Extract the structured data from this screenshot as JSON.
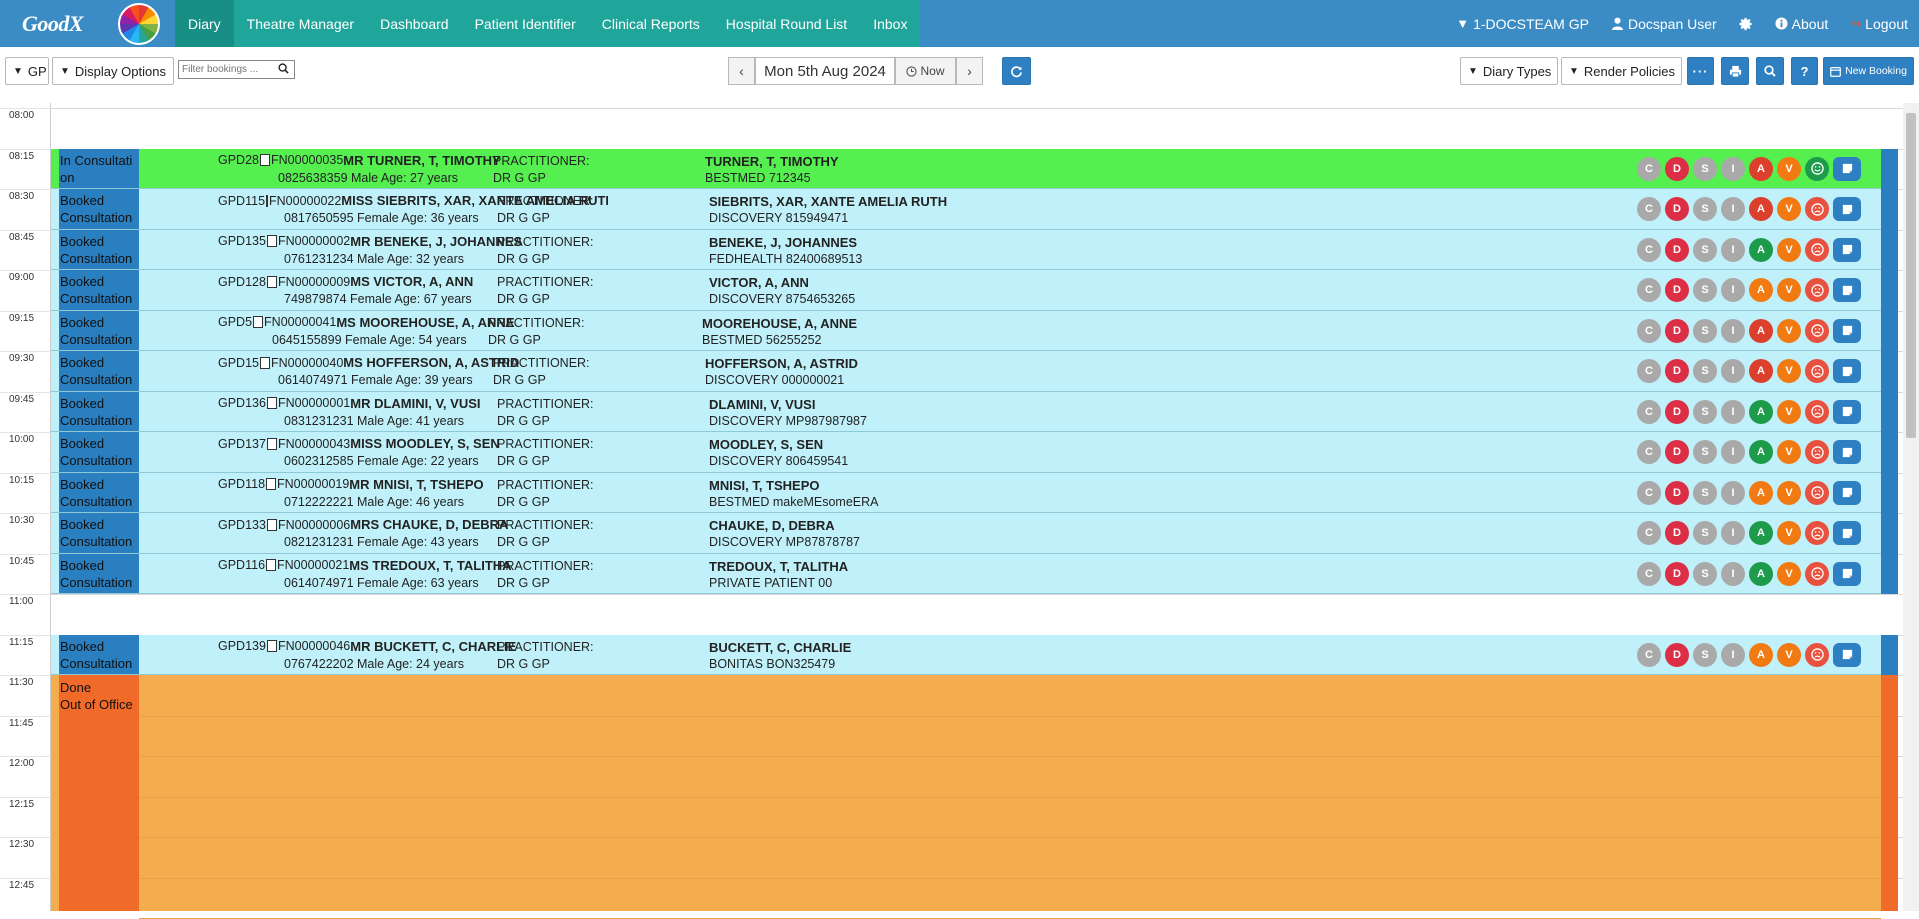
{
  "nav": {
    "logo_text": "GoodX",
    "items": [
      {
        "label": "Diary",
        "active": true
      },
      {
        "label": "Theatre Manager"
      },
      {
        "label": "Dashboard"
      },
      {
        "label": "Patient Identifier"
      },
      {
        "label": "Clinical Reports"
      },
      {
        "label": "Hospital Round List"
      },
      {
        "label": "Inbox"
      }
    ],
    "entity": "1-DOCSTEAM GP",
    "user": "Docspan User",
    "about": "About",
    "logout": "Logout"
  },
  "toolbar": {
    "gp_label": "GP",
    "display_options": "Display Options",
    "filter_placeholder": "Filter bookings ...",
    "date": "Mon 5th Aug 2024",
    "now": "Now",
    "diary_types": "Diary Types",
    "render_policies": "Render Policies",
    "new_booking": "New Booking"
  },
  "times": [
    "08:00",
    "08:15",
    "08:30",
    "08:45",
    "09:00",
    "09:15",
    "09:30",
    "09:45",
    "10:00",
    "10:15",
    "10:30",
    "10:45",
    "11:00",
    "11:15",
    "11:30",
    "11:45",
    "12:00",
    "12:15",
    "12:30",
    "12:45"
  ],
  "bookings": [
    {
      "slot": 1,
      "status1": "In Consultati",
      "status2": "on",
      "ref": "GPD28",
      "file": "FN00000035",
      "name": "MR TURNER, T, TIMOTHY",
      "details": "0825638359 Male Age: 27 years",
      "prac_label": "PRACTITIONER:",
      "prac": "DR G GP",
      "patient": "TURNER, T, TIMOTHY",
      "medical": "BESTMED 712345",
      "a": "red",
      "face": "happy",
      "kind": "green"
    },
    {
      "slot": 2,
      "status1": "Booked",
      "status2": "Consultation",
      "ref": "GPD115",
      "file": "FN00000022",
      "name": "MISS SIEBRITS, XAR, XANTE AMELIA RUTH",
      "details": "0817650595 Female Age: 36 years",
      "prac_label": "PRACTITIONER:",
      "prac": "DR G GP",
      "patient": "SIEBRITS, XAR, XANTE AMELIA RUTH",
      "medical": "DISCOVERY 815949471",
      "a": "red",
      "face": "sad",
      "kind": "blue"
    },
    {
      "slot": 3,
      "status1": "Booked",
      "status2": "Consultation",
      "ref": "GPD135",
      "file": "FN00000002",
      "name": "MR BENEKE, J, JOHANNES",
      "details": "0761231234 Male Age: 32 years",
      "prac_label": "PRACTITIONER:",
      "prac": "DR G GP",
      "patient": "BENEKE, J, JOHANNES",
      "medical": "FEDHEALTH 82400689513",
      "a": "green",
      "face": "sad",
      "kind": "blue"
    },
    {
      "slot": 4,
      "status1": "Booked",
      "status2": "Consultation",
      "ref": "GPD128",
      "file": "FN00000009",
      "name": "MS VICTOR, A, ANN",
      "details": "749879874 Female Age: 67 years",
      "prac_label": "PRACTITIONER:",
      "prac": "DR G GP",
      "patient": "VICTOR, A, ANN",
      "medical": "DISCOVERY 8754653265",
      "a": "orange",
      "face": "sad",
      "kind": "blue"
    },
    {
      "slot": 5,
      "status1": "Booked",
      "status2": "Consultation",
      "ref": "GPD5",
      "file": "FN00000041",
      "name": "MS MOOREHOUSE, A, ANNE",
      "details": "0645155899 Female Age: 54 years",
      "prac_label": "PRACTITIONER:",
      "prac": "DR G GP",
      "patient": "MOOREHOUSE, A, ANNE",
      "medical": "BESTMED 56255252",
      "a": "red",
      "face": "sad",
      "kind": "blue"
    },
    {
      "slot": 6,
      "status1": "Booked",
      "status2": "Consultation",
      "ref": "GPD15",
      "file": "FN00000040",
      "name": "MS HOFFERSON, A, ASTRID",
      "details": "0614074971 Female Age: 39 years",
      "prac_label": "PRACTITIONER:",
      "prac": "DR G GP",
      "patient": "HOFFERSON, A, ASTRID",
      "medical": "DISCOVERY 000000021",
      "a": "red",
      "face": "sad",
      "kind": "blue"
    },
    {
      "slot": 7,
      "status1": "Booked",
      "status2": "Consultation",
      "ref": "GPD136",
      "file": "FN00000001",
      "name": "MR DLAMINI, V, VUSI",
      "details": "0831231231 Male Age: 41 years",
      "prac_label": "PRACTITIONER:",
      "prac": "DR G GP",
      "patient": "DLAMINI, V, VUSI",
      "medical": "DISCOVERY MP987987987",
      "a": "green",
      "face": "sad",
      "kind": "blue"
    },
    {
      "slot": 8,
      "status1": "Booked",
      "status2": "Consultation",
      "ref": "GPD137",
      "file": "FN00000043",
      "name": "MISS MOODLEY, S, SEN",
      "details": "0602312585 Female Age: 22 years",
      "prac_label": "PRACTITIONER:",
      "prac": "DR G GP",
      "patient": "MOODLEY, S, SEN",
      "medical": "DISCOVERY 806459541",
      "a": "green",
      "face": "sad",
      "kind": "blue"
    },
    {
      "slot": 9,
      "status1": "Booked",
      "status2": "Consultation",
      "ref": "GPD118",
      "file": "FN00000019",
      "name": "MR MNISI, T, TSHEPO",
      "details": "0712222221 Male Age: 46 years",
      "prac_label": "PRACTITIONER:",
      "prac": "DR G GP",
      "patient": "MNISI, T, TSHEPO",
      "medical": "BESTMED makeMEsomeERA",
      "a": "orange",
      "face": "sad",
      "kind": "blue"
    },
    {
      "slot": 10,
      "status1": "Booked",
      "status2": "Consultation",
      "ref": "GPD133",
      "file": "FN00000006",
      "name": "MRS CHAUKE, D, DEBRA",
      "details": "0821231231 Female Age: 43 years",
      "prac_label": "PRACTITIONER:",
      "prac": "DR G GP",
      "patient": "CHAUKE, D, DEBRA",
      "medical": "DISCOVERY MP87878787",
      "a": "green",
      "face": "sad",
      "kind": "blue"
    },
    {
      "slot": 11,
      "status1": "Booked",
      "status2": "Consultation",
      "ref": "GPD116",
      "file": "FN00000021",
      "name": "MS TREDOUX, T, TALITHA",
      "details": "0614074971 Female Age: 63 years",
      "prac_label": "PRACTITIONER:",
      "prac": "DR G GP",
      "patient": "TREDOUX, T, TALITHA",
      "medical": "PRIVATE PATIENT 00",
      "a": "green",
      "face": "sad",
      "kind": "blue"
    },
    {
      "slot": 13,
      "status1": "Booked",
      "status2": "Consultation",
      "ref": "GPD139",
      "file": "FN00000046",
      "name": "MR BUCKETT, C, CHARLIE",
      "details": "0767422202 Male Age: 24 years",
      "prac_label": "PRACTITIONER:",
      "prac": "DR G GP",
      "patient": "BUCKETT, C, CHARLIE",
      "medical": "BONITAS BON325479",
      "a": "orange",
      "face": "sad",
      "kind": "blue"
    }
  ],
  "out_of_office": {
    "status1": "Done",
    "status2": "Out of Office"
  },
  "icon_letters": {
    "c": "C",
    "d": "D",
    "s": "S",
    "i": "I",
    "a": "A",
    "v": "V"
  },
  "colors": {
    "nav": "#3b8cc4",
    "nav_teal": "#1fa59a",
    "in_consultation": "#55f04f",
    "booked": "#c0f1fa",
    "status_blue": "#2a7fc1",
    "out_of_office": "#f3ad4f",
    "ooo_strip": "#f06a2a"
  }
}
